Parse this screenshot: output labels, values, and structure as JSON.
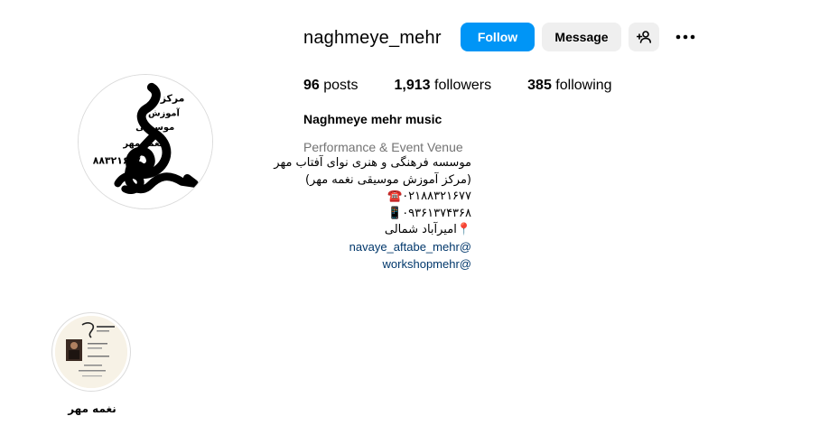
{
  "profile": {
    "username": "naghmeye_mehr",
    "full_name": "Naghmeye mehr music",
    "category": "Performance & Event Venue",
    "avatar_icon": "treble-clef-logo",
    "avatar_text": [
      "مرکز",
      "آموزش",
      "موسیقی",
      "نغمه مهر",
      "۸۸۳۲۱۶۷۷"
    ]
  },
  "actions": {
    "follow_label": "Follow",
    "message_label": "Message",
    "add_user_icon": "person-add-icon",
    "more_icon": "more-horizontal-icon",
    "follow_color": "#0095f6"
  },
  "stats": {
    "posts_count": "96",
    "posts_label": "posts",
    "followers_count": "1,913",
    "followers_label": "followers",
    "following_count": "385",
    "following_label": "following"
  },
  "bio": {
    "lines": [
      "موسسه فرهنگی و هنری نوای آفتاب مهر",
      "(مرکز آموزش موسیقی نغمه مهر)",
      "۰۲۱۸۸۳۲۱۶۷۷☎️",
      "۰۹۳۶۱۳۷۴۳۶۸📱",
      "📍امیرآباد شمالی"
    ],
    "links": [
      "@navaye_aftabe_mehr",
      "@workshopmehr"
    ]
  },
  "highlights": [
    {
      "label": "نغمه مهر"
    }
  ]
}
